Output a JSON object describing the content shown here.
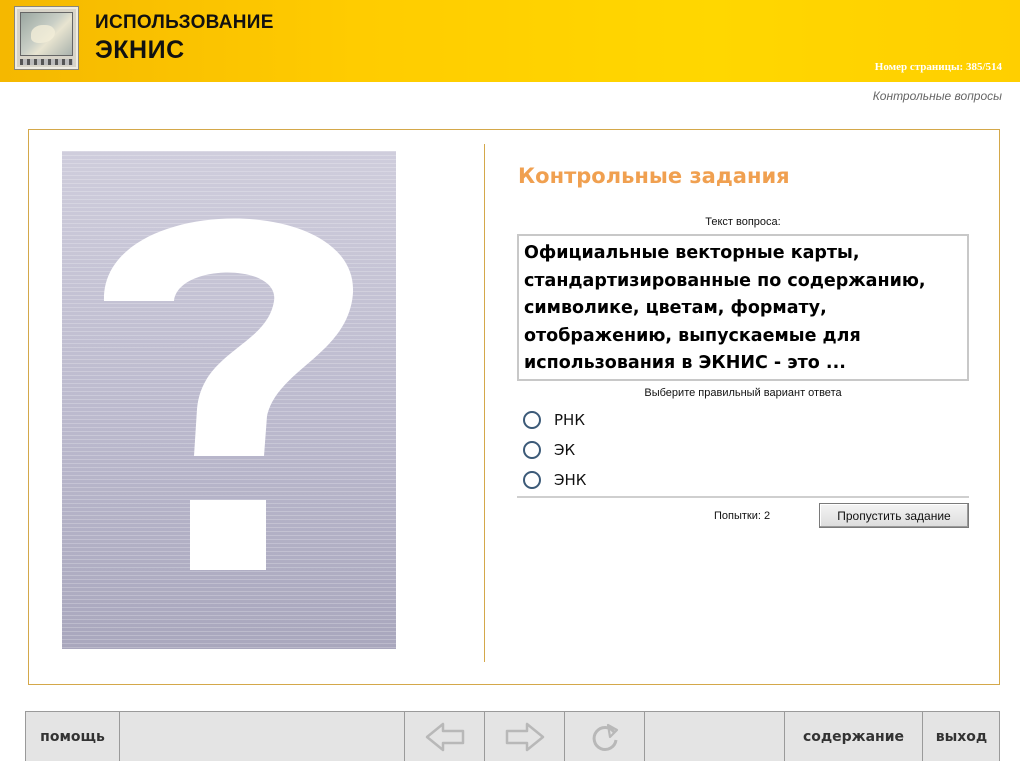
{
  "header": {
    "title_line1": "ИСПОЛЬЗОВАНИЕ",
    "title_line2": "ЭКНИС",
    "page_number": "Номер страницы: 385/514",
    "section": "Контрольные вопросы"
  },
  "main": {
    "image_icon": "question-mark-icon",
    "task_title": "Контрольные задания",
    "question_label": "Текст вопроса:",
    "question_lines": [
      "Официальные векторные карты,",
      "стандартизированные по содержанию,",
      "символике, цветам, формату,",
      "отображению, выпускаемые для",
      "использования в ЭКНИС - это ..."
    ],
    "answer_label": "Выберите правильный вариант ответа",
    "options": [
      "РНК",
      "ЭК",
      "ЭНК"
    ],
    "attempts": "Попытки: 2",
    "skip_label": "Пропустить задание"
  },
  "footer": {
    "help": "помощь",
    "back_icon": "arrow-left-icon",
    "forward_icon": "arrow-right-icon",
    "refresh_icon": "refresh-icon",
    "contents": "содержание",
    "exit": "выход"
  },
  "colors": {
    "header_yellow": "#ffcc00",
    "accent_orange": "#f0a050",
    "frame_border": "#d4a84a",
    "radio_border": "#3c5a78"
  }
}
